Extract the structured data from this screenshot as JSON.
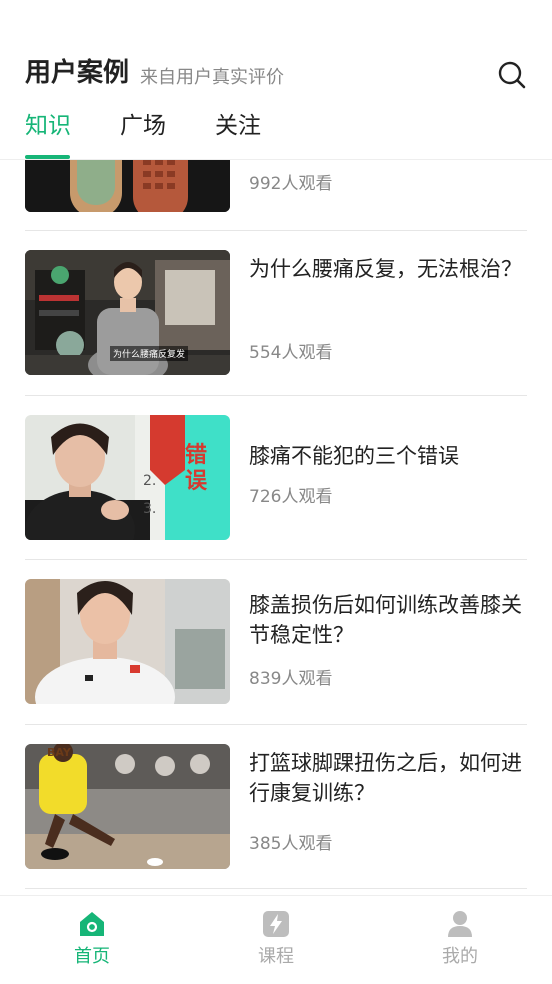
{
  "header": {
    "title": "用户案例",
    "subtitle": "来自用户真实评价",
    "search_icon": "search-icon"
  },
  "tabs": [
    {
      "label": "知识",
      "active": true
    },
    {
      "label": "广场",
      "active": false
    },
    {
      "label": "关注",
      "active": false
    }
  ],
  "articles": [
    {
      "title": "",
      "views": "992人观看"
    },
    {
      "title": "为什么腰痛反复，无法根治？",
      "views": "554人观看"
    },
    {
      "title": "膝痛不能犯的三个错误",
      "views": "726人观看"
    },
    {
      "title": "膝盖损伤后如何训练改善膝关节稳定性？",
      "views": "839人观看"
    },
    {
      "title": "打篮球脚踝扭伤之后，如何进行康复训练？",
      "views": "385人观看"
    }
  ],
  "thumb_text": {
    "video1_caption": "为什么腰痛反复发",
    "video2_board": "错误",
    "video2_list": [
      "2.",
      "3."
    ],
    "video4_jersey": "BAY"
  },
  "bottom_nav": [
    {
      "label": "首页",
      "icon": "home-icon",
      "active": true
    },
    {
      "label": "课程",
      "icon": "course-icon",
      "active": false
    },
    {
      "label": "我的",
      "icon": "profile-icon",
      "active": false
    }
  ],
  "colors": {
    "accent": "#16b577",
    "muted": "#888888"
  }
}
